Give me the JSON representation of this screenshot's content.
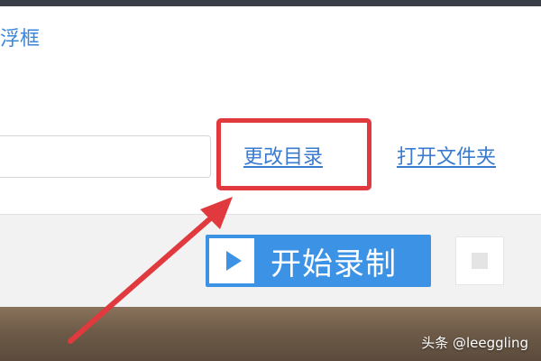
{
  "recorder": {
    "float_window_label": "浮框",
    "path_value": "",
    "change_directory_label": "更改目录",
    "open_folder_label": "打开文件夹",
    "start_recording_label": "开始录制"
  },
  "annotation": {
    "highlight_color": "#e0393e"
  },
  "watermark": {
    "text": "头条 @leeggling"
  },
  "colors": {
    "accent": "#3c93e6",
    "link": "#3a7bd0"
  }
}
